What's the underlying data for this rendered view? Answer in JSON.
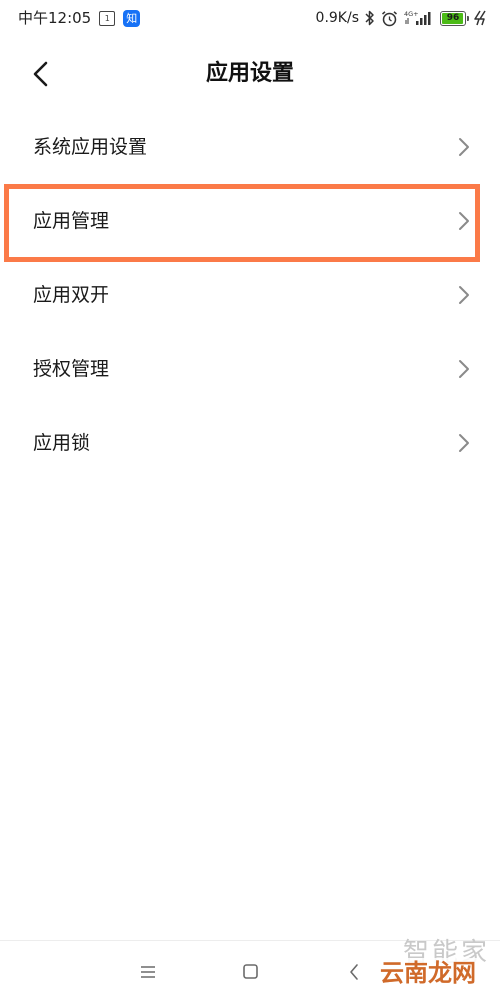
{
  "status_bar": {
    "time": "中午12:05",
    "calendar_day": "1",
    "app_badge": "知",
    "network_speed": "0.9K/s",
    "network_type": "4G+",
    "battery_level": "96"
  },
  "header": {
    "title": "应用设置"
  },
  "list": {
    "items": [
      {
        "label": "系统应用设置"
      },
      {
        "label": "应用管理"
      },
      {
        "label": "应用双开"
      },
      {
        "label": "授权管理"
      },
      {
        "label": "应用锁"
      }
    ]
  },
  "highlight": {
    "target": "应用管理",
    "color": "#fb7a48"
  },
  "watermark": {
    "line1": "智能家",
    "line2": "云南龙网"
  },
  "colors": {
    "text": "#1a1a1a",
    "chevron": "#8a8a8a",
    "battery": "#4cbb17",
    "app_badge": "#1772f6"
  },
  "icons": {
    "back": "chevron-left-icon",
    "row_arrow": "chevron-right-icon",
    "nav_menu": "menu-icon",
    "nav_home": "home-icon",
    "nav_back": "back-icon"
  }
}
